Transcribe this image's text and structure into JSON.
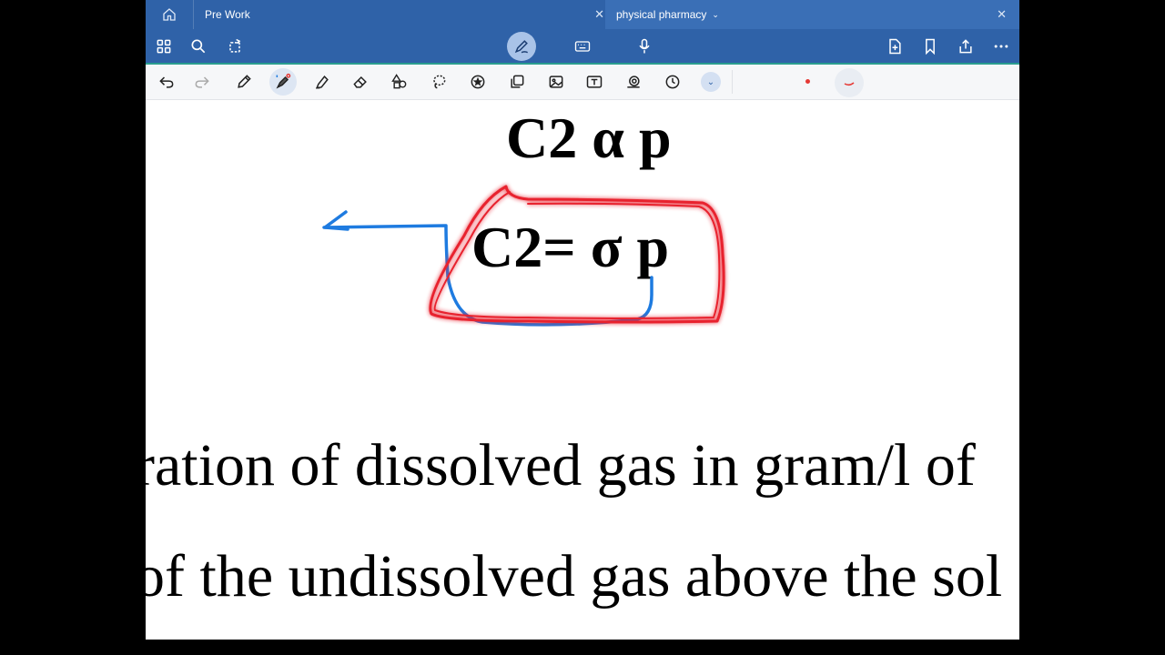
{
  "tabs": [
    {
      "label": "Pre Work",
      "active": false
    },
    {
      "label": "physical pharmacy",
      "active": true
    }
  ],
  "toolbar_icons": [
    "grid-icon",
    "search-icon",
    "rotate-page-icon",
    "pen-mode-icon",
    "keyboard-icon",
    "mic-icon",
    "add-page-icon",
    "bookmark-icon",
    "share-icon",
    "more-icon"
  ],
  "tools": [
    "undo-icon",
    "redo-icon",
    "pen-icon",
    "laser-pointer-icon",
    "highlighter-icon",
    "eraser-icon",
    "shapes-icon",
    "lasso-icon",
    "sticker-icon",
    "copy-icon",
    "image-icon",
    "text-box-icon",
    "camera-icon",
    "timer-icon",
    "expand-tools-icon"
  ],
  "colors": {
    "accent": "#2f62a8",
    "ink_red": "#e53935",
    "ink_blue": "#1e7be0"
  },
  "canvas": {
    "equation_1": "C2 α p",
    "equation_2": "C2=   σ p",
    "text_line_1": "ration of dissolved gas in gram/l of",
    "text_line_2": "of the undissolved gas above the sol"
  }
}
